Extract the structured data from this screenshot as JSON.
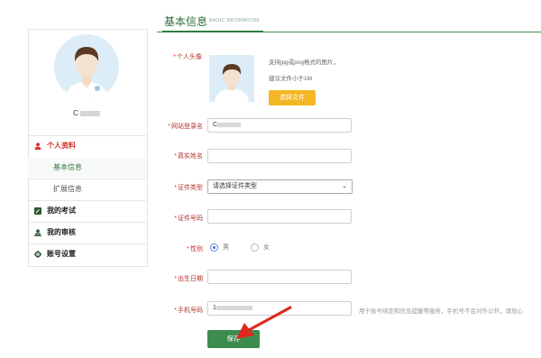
{
  "header": {
    "title": "基本信息",
    "subtitle": "BASIC INFOMATION"
  },
  "sidebar": {
    "username": "C",
    "menu": [
      {
        "label": "个人资料",
        "icon": "user-icon",
        "active": true
      },
      {
        "label": "基本信息",
        "active": true
      },
      {
        "label": "扩展信息"
      },
      {
        "label": "我的考试",
        "icon": "exam-icon"
      },
      {
        "label": "我的审核",
        "icon": "review-icon"
      },
      {
        "label": "账号设置",
        "icon": "gear-icon"
      }
    ]
  },
  "form": {
    "avatar_label": "个人头像",
    "upload_hint1": "支持jpg或png格式的图片，",
    "upload_hint2": "建议文件小于1M",
    "upload_button": "选择文件",
    "login_label": "网站登录名",
    "login_value": "C",
    "realname_label": "真实姓名",
    "idtype_label": "证件类型",
    "idtype_value": "请选择证件类型",
    "idnumber_label": "证件号码",
    "gender_label": "性别",
    "gender_male": "男",
    "gender_female": "女",
    "gender_selected": "男",
    "birth_label": "出生日期",
    "phone_label": "手机号码",
    "phone_value": "1",
    "phone_hint": "用于账号绑定和信息提醒等服务，手机号不会对外公开，请放心",
    "save_button": "保存",
    "star": "*"
  },
  "colors": {
    "accent_green": "#3d8b4e",
    "required_red": "#d9322b",
    "file_button": "#f4b724"
  }
}
